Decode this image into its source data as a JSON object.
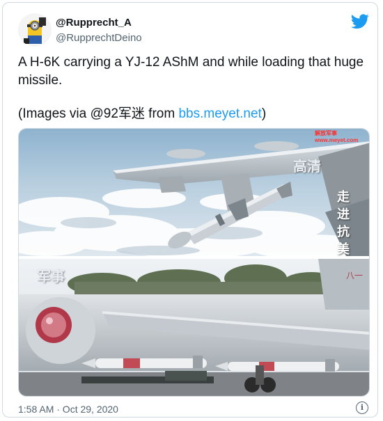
{
  "author": {
    "display_name": "@Rupprecht_A",
    "handle": "@RupprechtDeino",
    "avatar_icon": "minion-avatar"
  },
  "tweet": {
    "line1": "A H-6K carrying a YJ-12 AShM and while loading that huge missile.",
    "credit_prefix": "(Images via ",
    "credit_user": "@92军迷",
    "credit_from": " from ",
    "credit_link": "bbs.meyet.net",
    "credit_suffix": ")"
  },
  "media": {
    "top_watermark": "高清",
    "top_vertical_caption": "走进抗美",
    "top_corner_text": "解放军事 www.meyet.com",
    "bottom_watermark": "军事"
  },
  "footer": {
    "timestamp": "1:58 AM · Oct 29, 2020",
    "info_icon": "info-icon"
  },
  "colors": {
    "link": "#1d9bf0",
    "twitter_blue": "#1d9bf0",
    "text_secondary": "#536471"
  }
}
